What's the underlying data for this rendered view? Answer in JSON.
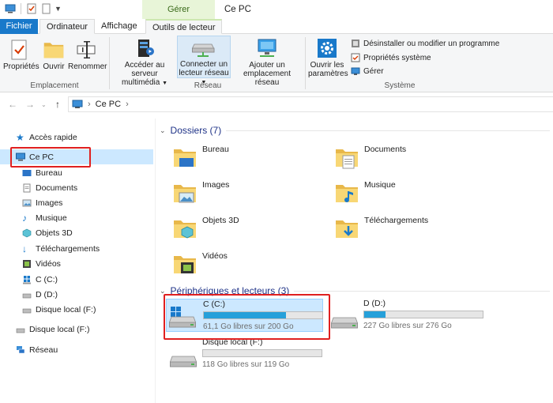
{
  "window": {
    "title": "Ce PC",
    "context_tab": "Gérer"
  },
  "tabs": {
    "fichier": "Fichier",
    "ordinateur": "Ordinateur",
    "affichage": "Affichage",
    "outils": "Outils de lecteur"
  },
  "ribbon": {
    "emplacement": {
      "label": "Emplacement",
      "proprietes": "Propriétés",
      "ouvrir": "Ouvrir",
      "renommer": "Renommer"
    },
    "reseau": {
      "label": "Réseau",
      "acceder_line1": "Accéder au serveur",
      "acceder_line2": "multimédia",
      "connecter_line1": "Connecter un",
      "connecter_line2": "lecteur réseau",
      "ajouter_line1": "Ajouter un",
      "ajouter_line2": "emplacement réseau"
    },
    "systeme": {
      "label": "Système",
      "parametres_line1": "Ouvrir les",
      "parametres_line2": "paramètres",
      "desinstaller": "Désinstaller ou modifier un programme",
      "proprietes_systeme": "Propriétés système",
      "gerer": "Gérer"
    }
  },
  "address": {
    "path": "Ce PC"
  },
  "nav": {
    "acces_rapide": "Accès rapide",
    "ce_pc": "Ce PC",
    "bureau": "Bureau",
    "documents": "Documents",
    "images": "Images",
    "musique": "Musique",
    "objets3d": "Objets 3D",
    "telechargements": "Téléchargements",
    "videos": "Vidéos",
    "c": "C (C:)",
    "d": "D (D:)",
    "f": "Disque local (F:)",
    "f2": "Disque local (F:)",
    "reseau": "Réseau"
  },
  "folders": {
    "header": "Dossiers (7)",
    "items": [
      "Bureau",
      "Documents",
      "Images",
      "Musique",
      "Objets 3D",
      "Téléchargements",
      "Vidéos"
    ]
  },
  "drives": {
    "header": "Périphériques et lecteurs (3)",
    "items": [
      {
        "name": "C (C:)",
        "free": "61,1 Go libres sur 200 Go",
        "used_fraction": 0.695
      },
      {
        "name": "D (D:)",
        "free": "227 Go libres sur 276 Go",
        "used_fraction": 0.178
      },
      {
        "name": "Disque local (F:)",
        "free": "118 Go libres sur 119 Go",
        "used_fraction": 0.0
      }
    ]
  },
  "colors": {
    "accent": "#1979ca",
    "selection": "#cce8ff",
    "highlight_box": "#e02020",
    "bar_fill": "#26a0da"
  }
}
